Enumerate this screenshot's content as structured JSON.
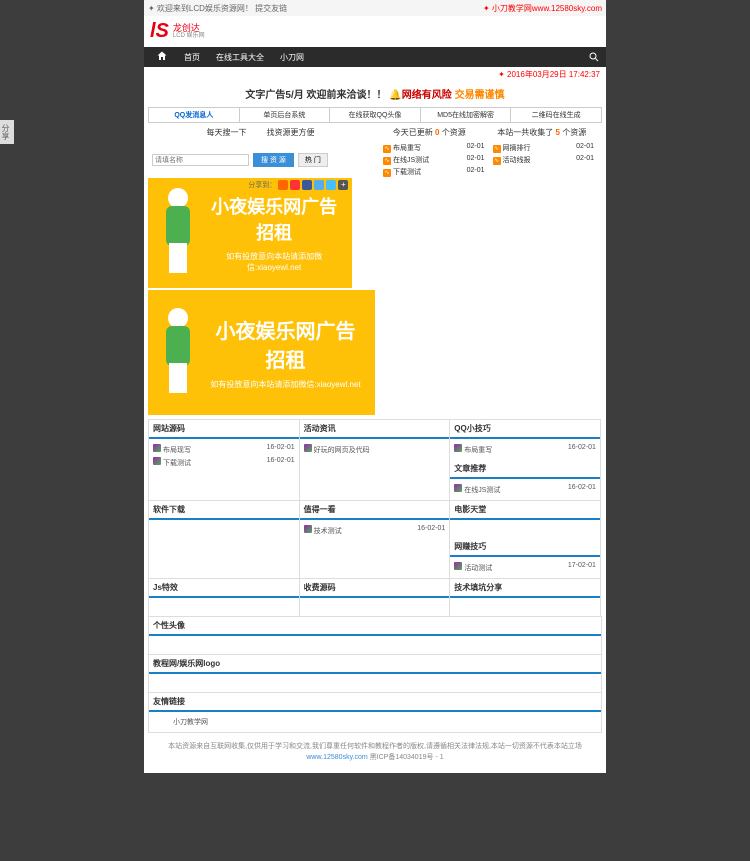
{
  "topbar": {
    "welcome": "✦ 欢迎来到LCD娱乐资源网！",
    "links": "提交友链",
    "promo": "✦ 小刀教学网www.12580sky.com"
  },
  "logo": {
    "main": "龙创达",
    "sub": "LCD 娱乐网"
  },
  "nav": {
    "home": "首页",
    "tools": "在线工具大全",
    "xiaodao": "小刀网"
  },
  "datetime": "✦ 2016年03月29日 17:42:37",
  "ad": {
    "t1": "文字广告5/月 欢迎前来洽谈！！",
    "t2": "🔔网络有风险",
    "t3": "交易需谨慎"
  },
  "tools": {
    "t1": "QQ发消息人",
    "t2": "单页后台系统",
    "t3": "在线获取QQ头像",
    "t4": "MD5在线加密解密",
    "t5": "二维码在线生成"
  },
  "stats": {
    "s1": "每天搜一下",
    "s2": "找资源更方便",
    "s3a": "今天已更新",
    "s3n": "0",
    "s3b": "个资源",
    "s4a": "本站一共收集了",
    "s4n": "5",
    "s4b": "个资源"
  },
  "search": {
    "ph": "请填名称",
    "btn1": "搜 资 源",
    "btn2": "热 门"
  },
  "res": [
    {
      "t": "布局重写",
      "d": "02-01"
    },
    {
      "t": "网摘排行",
      "d": "02-01"
    },
    {
      "t": "在线JS测试",
      "d": "02-01"
    },
    {
      "t": "活动线报",
      "d": "02-01"
    },
    {
      "t": "下载测试",
      "d": "02-01"
    }
  ],
  "share": {
    "label": "分享到：",
    "colors": [
      "#ff6600",
      "#ff3333",
      "#3b5998",
      "#55acee",
      "#46c0fb",
      "#555"
    ]
  },
  "banner": {
    "title": "小夜娱乐网广告招租",
    "sub": "如有投放意向本站请添加微信:xiaoyewl.net"
  },
  "sections": {
    "s1": {
      "h": "网站源码",
      "items": [
        {
          "t": "布局现写",
          "d": "16-02-01"
        },
        {
          "t": "下载测试",
          "d": "16-02-01"
        }
      ]
    },
    "s2": {
      "h": "活动资讯",
      "items": [
        {
          "t": "好玩的网页及代码",
          "d": ""
        }
      ]
    },
    "s3": {
      "h": "QQ小技巧",
      "items": [
        {
          "t": "布局重写",
          "d": "16-02-01"
        }
      ]
    },
    "s4": {
      "h": "文章推荐",
      "items": [
        {
          "t": "在线JS测试",
          "d": "16-02-01"
        }
      ]
    },
    "s5": {
      "h": "软件下载",
      "items": []
    },
    "s6": {
      "h": "值得一看",
      "items": [
        {
          "t": "技术测试",
          "d": "16-02-01"
        }
      ]
    },
    "s7": {
      "h": "电影天堂",
      "items": []
    },
    "s8": {
      "h": "网赚技巧",
      "items": [
        {
          "t": "活动测试",
          "d": "17-02-01"
        }
      ]
    },
    "s9": {
      "h": "Js特效",
      "items": []
    },
    "s10": {
      "h": "收费源码",
      "items": []
    },
    "s11": {
      "h": "技术填坑分享",
      "items": []
    },
    "s12": {
      "h": "个性头像",
      "items": []
    },
    "s13": {
      "h": "教程网/娱乐网logo",
      "items": []
    },
    "s14": {
      "h": "友情链接",
      "items": [
        {
          "t": "小刀教学网",
          "d": ""
        }
      ]
    }
  },
  "footer": {
    "l1": "本站资源来自互联网收集,仅供用于学习和交流,我们尊重任何软件和教程作者的版权,请遵循相关法律法规,本站一切资源不代表本站立场",
    "l2": "www.12580sky.com",
    "l3": "黑ICP备14034019号 - 1"
  },
  "sidetab": "分享"
}
